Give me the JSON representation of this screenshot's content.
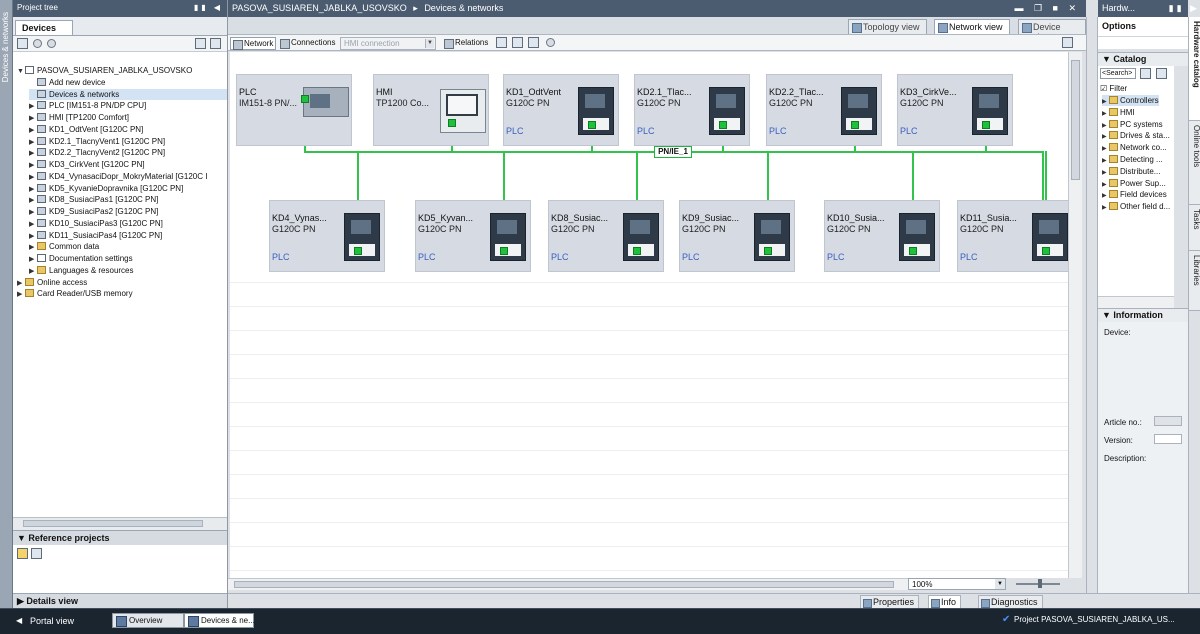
{
  "left_strip": {
    "label": "Devices & networks"
  },
  "project_tree": {
    "title": "Project tree",
    "devices_tab": "Devices",
    "items": [
      {
        "label": "PASOVA_SUSIAREN_JABLKA_USOVSKO",
        "level": 0,
        "arrow": "▼",
        "icon": "document-icon"
      },
      {
        "label": "Add new device",
        "level": 1,
        "arrow": "",
        "icon": "add-device-icon"
      },
      {
        "label": "Devices & networks",
        "level": 1,
        "arrow": "",
        "icon": "network-icon",
        "selected": true
      },
      {
        "label": "PLC [IM151-8 PN/DP CPU]",
        "level": 1,
        "arrow": "▶",
        "icon": "device-icon"
      },
      {
        "label": "HMI [TP1200 Comfort]",
        "level": 1,
        "arrow": "▶",
        "icon": "device-icon"
      },
      {
        "label": "KD1_OdtVent [G120C PN]",
        "level": 1,
        "arrow": "▶",
        "icon": "device-icon"
      },
      {
        "label": "KD2.1_TlacnyVent1 [G120C PN]",
        "level": 1,
        "arrow": "▶",
        "icon": "device-icon"
      },
      {
        "label": "KD2.2_TlacnyVent2 [G120C PN]",
        "level": 1,
        "arrow": "▶",
        "icon": "device-icon"
      },
      {
        "label": "KD3_CirkVent [G120C PN]",
        "level": 1,
        "arrow": "▶",
        "icon": "device-icon"
      },
      {
        "label": "KD4_VynasaciDopr_MokryMaterial [G120C I",
        "level": 1,
        "arrow": "▶",
        "icon": "device-icon"
      },
      {
        "label": "KD5_KyvanieDopravnika [G120C PN]",
        "level": 1,
        "arrow": "▶",
        "icon": "device-icon"
      },
      {
        "label": "KD8_SusiaciPas1 [G120C PN]",
        "level": 1,
        "arrow": "▶",
        "icon": "device-icon"
      },
      {
        "label": "KD9_SusiaciPas2 [G120C PN]",
        "level": 1,
        "arrow": "▶",
        "icon": "device-icon"
      },
      {
        "label": "KD10_SusiaciPas3 [G120C PN]",
        "level": 1,
        "arrow": "▶",
        "icon": "device-icon"
      },
      {
        "label": "KD11_SusiaciPas4 [G120C PN]",
        "level": 1,
        "arrow": "▶",
        "icon": "device-icon"
      },
      {
        "label": "Common data",
        "level": 1,
        "arrow": "▶",
        "icon": "folder-icon"
      },
      {
        "label": "Documentation settings",
        "level": 1,
        "arrow": "▶",
        "icon": "document-icon"
      },
      {
        "label": "Languages & resources",
        "level": 1,
        "arrow": "▶",
        "icon": "folder-icon"
      },
      {
        "label": "Online access",
        "level": 0,
        "arrow": "▶",
        "icon": "folder-icon"
      },
      {
        "label": "Card Reader/USB memory",
        "level": 0,
        "arrow": "▶",
        "icon": "folder-icon"
      }
    ],
    "reference_projects": "Reference projects",
    "details_view": "Details view"
  },
  "editor": {
    "breadcrumb_project": "PASOVA_SUSIAREN_JABLKA_USOVSKO",
    "breadcrumb_sep": "▸",
    "breadcrumb_page": "Devices & networks",
    "view_tabs": [
      "Topology view",
      "Network view",
      "Device view"
    ],
    "active_view": "Network view",
    "toolbar": {
      "network": "Network",
      "connections": "Connections",
      "hmi_connection": "HMI connection",
      "relations": "Relations"
    },
    "zoom": "100%",
    "subnet_label": "PN/IE_1",
    "devices_top": [
      {
        "name": "PLC",
        "type": "IM151-8 PN/...",
        "kind": "plc",
        "plc_link": ""
      },
      {
        "name": "HMI",
        "type": "TP1200 Co...",
        "kind": "hmi",
        "plc_link": ""
      },
      {
        "name": "KD1_OdtVent",
        "type": "G120C PN",
        "kind": "drive",
        "plc_link": "PLC"
      },
      {
        "name": "KD2.1_Tlac...",
        "type": "G120C PN",
        "kind": "drive",
        "plc_link": "PLC"
      },
      {
        "name": "KD2.2_Tlac...",
        "type": "G120C PN",
        "kind": "drive",
        "plc_link": "PLC"
      },
      {
        "name": "KD3_CirkVe...",
        "type": "G120C PN",
        "kind": "drive",
        "plc_link": "PLC"
      }
    ],
    "devices_bottom": [
      {
        "name": "KD4_Vynas...",
        "type": "G120C PN",
        "plc_link": "PLC"
      },
      {
        "name": "KD5_Kyvan...",
        "type": "G120C PN",
        "plc_link": "PLC"
      },
      {
        "name": "KD8_Susiac...",
        "type": "G120C PN",
        "plc_link": "PLC"
      },
      {
        "name": "KD9_Susiac...",
        "type": "G120C PN",
        "plc_link": "PLC"
      },
      {
        "name": "KD10_Susia...",
        "type": "G120C PN",
        "plc_link": "PLC"
      },
      {
        "name": "KD11_Susia...",
        "type": "G120C PN",
        "plc_link": "PLC"
      }
    ]
  },
  "right_panel": {
    "title": "Hardw...",
    "options": "Options",
    "catalog": "Catalog",
    "search_placeholder": "<Search>",
    "filter": "Filter",
    "catalog_items": [
      "Controllers",
      "HMI",
      "PC systems",
      "Drives & sta...",
      "Network co...",
      "Detecting ...",
      "Distribute...",
      "Power Sup...",
      "Field devices",
      "Other field d..."
    ],
    "information": "Information",
    "device_label": "Device:",
    "article_no": "Article no.:",
    "version": "Version:",
    "description": "Description:",
    "side_tabs": [
      "Hardware catalog",
      "Online tools",
      "Tasks",
      "Libraries"
    ]
  },
  "inspector": {
    "properties": "Properties",
    "info": "Info",
    "diagnostics": "Diagnostics"
  },
  "taskbar": {
    "portal_view": "Portal view",
    "overview": "Overview",
    "devices_task": "Devices & ne...",
    "status": "Project PASOVA_SUSIAREN_JABLKA_US..."
  }
}
